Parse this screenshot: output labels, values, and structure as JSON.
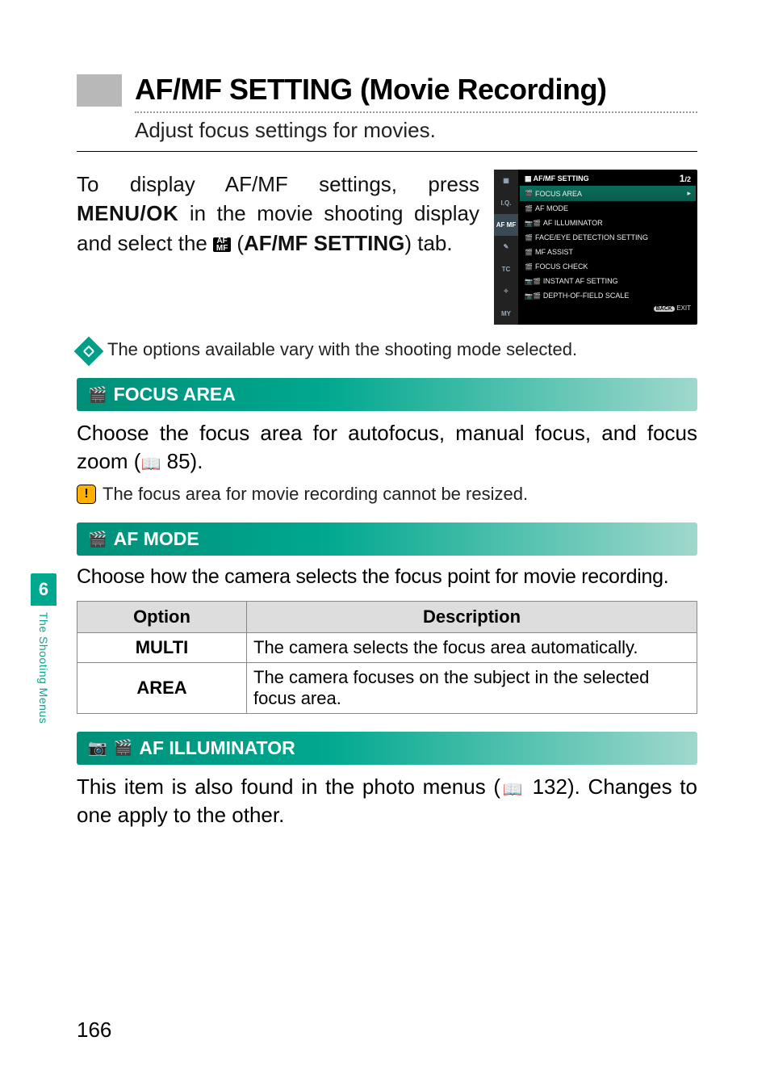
{
  "side_tab": {
    "number": "6",
    "label": "The Shooting Menus"
  },
  "title": "AF/MF SETTING (Movie Recording)",
  "subtitle": "Adjust focus settings for movies.",
  "intro": {
    "line1": "To display AF/MF settings, press ",
    "menuok": "MENU/OK",
    "line2": " in the movie shooting display and select the ",
    "afmf_icon": "AF\nMF",
    "line3": " (",
    "tab_bold": "AF/MF SETTING",
    "line4": ") tab."
  },
  "lcd": {
    "header": "AF/MF SETTING",
    "page": {
      "cur": "1",
      "total": "/2"
    },
    "tabs": [
      "▦",
      "I.Q.",
      "AF\nMF",
      "✎",
      "TC",
      "✧",
      "MY"
    ],
    "items": [
      "FOCUS AREA",
      "AF MODE",
      "AF ILLUMINATOR",
      "FACE/EYE DETECTION SETTING",
      "MF ASSIST",
      "FOCUS CHECK",
      "INSTANT AF SETTING",
      "DEPTH-OF-FIELD SCALE"
    ],
    "exit": "EXIT",
    "back": "BACK"
  },
  "note": "The options available vary with the shooting mode selected.",
  "sec_focus_area": "FOCUS AREA",
  "focus_para_a": "Choose the focus area for autofocus, manual focus, and focus zoom (",
  "focus_para_ref": "85",
  "focus_para_b": ").",
  "focus_warn": "The focus area for movie recording cannot be resized.",
  "sec_af_mode": "AF MODE",
  "afmode_para": "Choose how the camera selects the focus point for movie recording.",
  "table": {
    "h_option": "Option",
    "h_desc": "Description",
    "rows": [
      {
        "opt": "MULTI",
        "desc": "The camera selects the focus area automatically."
      },
      {
        "opt": "AREA",
        "desc": "The camera focuses on the subject in the selected focus area."
      }
    ]
  },
  "sec_illum": "AF ILLUMINATOR",
  "illum_para_a": "This item is also found in the photo menus (",
  "illum_ref": "132",
  "illum_para_b": "). Changes to one apply to the other.",
  "page_number": "166"
}
